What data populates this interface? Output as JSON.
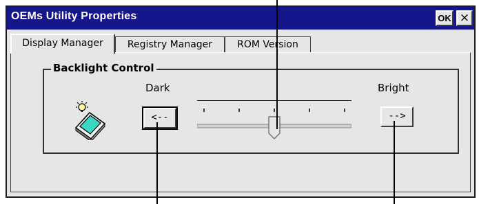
{
  "window": {
    "title": "OEMs Utility Properties",
    "ok_label": "OK",
    "close_label": "×"
  },
  "tabs": [
    {
      "label": "Display Manager",
      "active": true
    },
    {
      "label": "Registry Manager",
      "active": false
    },
    {
      "label": "ROM Version",
      "active": false
    }
  ],
  "backlight": {
    "group_title": "Backlight Control",
    "dark_label": "Dark",
    "bright_label": "Bright",
    "decrease_button": "<--",
    "increase_button": "-->",
    "level_fraction": 0.5,
    "tick_count": 5
  },
  "colors": {
    "titlebar": "#16168c",
    "window_bg": "#e6e6e6"
  },
  "icons": [
    "backlight-icon"
  ]
}
